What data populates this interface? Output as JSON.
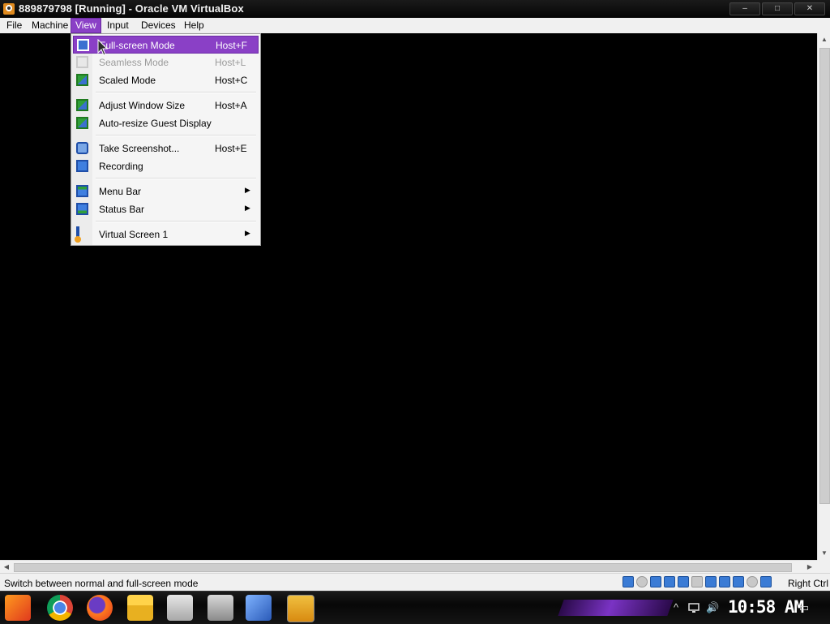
{
  "window": {
    "title": "889879798 [Running] - Oracle VM VirtualBox",
    "controls": {
      "minimize": "–",
      "maximize": "□",
      "close": "✕"
    }
  },
  "menubar": {
    "items": [
      {
        "label": "File"
      },
      {
        "label": "Machine"
      },
      {
        "label": "View",
        "active": true
      },
      {
        "label": "Input"
      },
      {
        "label": "Devices"
      },
      {
        "label": "Help"
      }
    ]
  },
  "view_menu": {
    "items": [
      {
        "label": "Full-screen Mode",
        "shortcut": "Host+F",
        "icon": "fullscreen-icon",
        "state": "highlighted"
      },
      {
        "label": "Seamless Mode",
        "shortcut": "Host+L",
        "icon": "seamless-icon",
        "state": "disabled"
      },
      {
        "label": "Scaled Mode",
        "shortcut": "Host+C",
        "icon": "scaled-icon"
      },
      {
        "label": "Adjust Window Size",
        "shortcut": "Host+A",
        "icon": "adjust-window-icon"
      },
      {
        "label": "Auto-resize Guest Display",
        "shortcut": "",
        "icon": "auto-resize-icon"
      },
      {
        "label": "Take Screenshot...",
        "shortcut": "Host+E",
        "icon": "screenshot-icon"
      },
      {
        "label": "Recording",
        "shortcut": "",
        "icon": "recording-icon"
      },
      {
        "label": "Menu Bar",
        "shortcut": "",
        "icon": "menu-bar-icon",
        "submenu": true
      },
      {
        "label": "Status Bar",
        "shortcut": "",
        "icon": "status-bar-icon",
        "submenu": true
      },
      {
        "label": "Virtual Screen 1",
        "shortcut": "",
        "icon": "virtual-screen-icon",
        "submenu": true
      }
    ],
    "submenu_glyph": "▶"
  },
  "statusbar": {
    "message": "Switch between normal and full-screen mode",
    "host_key": "Right Ctrl",
    "indicator_icons": [
      "hard-disk-icon",
      "optical-drive-icon",
      "audio-icon",
      "network-icon",
      "usb-icon",
      "shared-folder-icon",
      "display-icon",
      "video-capture-icon",
      "virtualization-icon",
      "mouse-integration-icon",
      "keyboard-icon"
    ]
  },
  "taskbar": {
    "clock": "10:58 AM",
    "apps": [
      "start-icon",
      "chrome-icon",
      "firefox-icon",
      "file-explorer-icon",
      "photos-icon",
      "virtual-machine-icon",
      "virtualbox-icon",
      "penguin-app-icon"
    ],
    "tray": [
      "show-hidden-icon",
      "network-icon",
      "volume-icon",
      "notification-icon"
    ],
    "tray_glyphs": {
      "show_hidden": "^",
      "volume": "🔊",
      "notification": "▭"
    }
  },
  "colors": {
    "menu_highlight": "#8a40c6",
    "title_bar": "#0d0d0d",
    "guest_background": "#000000"
  }
}
